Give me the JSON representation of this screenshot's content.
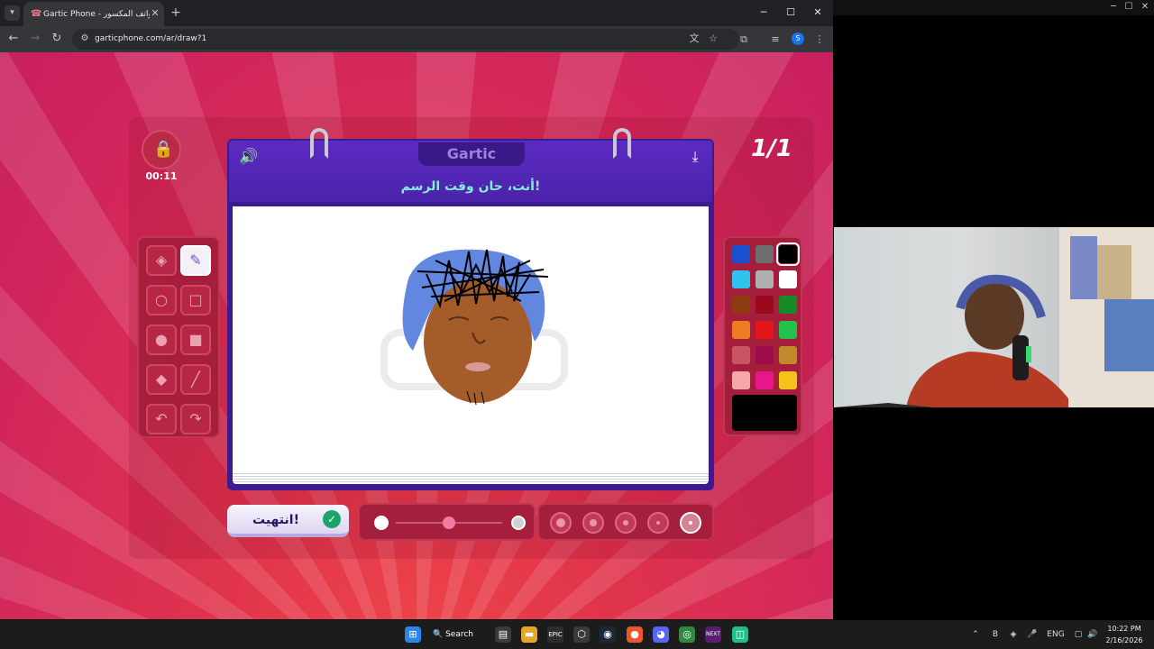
{
  "browser": {
    "tab_title": "Gartic Phone - الهواتف المكسور",
    "tab_close": "✕",
    "new_tab": "+",
    "url": "garticphone.com/ar/draw?1",
    "profile_initial": "S",
    "window_controls": {
      "minimize": "─",
      "maximize": "☐",
      "close": "✕"
    }
  },
  "game": {
    "brand": "Gartic",
    "prompt": "أنت، حان وقت الرسم!",
    "timer": "00:11",
    "round": "1/1",
    "done_label": "انتهيت!",
    "tools": [
      "eraser",
      "pencil",
      "ellipse-outline",
      "rectangle-outline",
      "ellipse-filled",
      "rectangle-filled",
      "fill-bucket",
      "line",
      "undo",
      "redo"
    ],
    "selected_tool": "pencil",
    "palette": [
      "#1a4fd0",
      "#6e6e6e",
      "#000000",
      "#2fc3f0",
      "#b0b0b0",
      "#ffffff",
      "#8e3b12",
      "#9a0a1c",
      "#178a2a",
      "#f07c21",
      "#e5161a",
      "#23c14a",
      "#c85562",
      "#9c0c4b",
      "#c08a2c",
      "#f6a7aa",
      "#e8168a",
      "#f5c21c"
    ],
    "selected_color": "#000000",
    "brush_level": 0.5
  },
  "taskbar": {
    "search_label": "Search",
    "lang": "ENG",
    "time": "10:22 PM",
    "date": "2/16/2026"
  }
}
